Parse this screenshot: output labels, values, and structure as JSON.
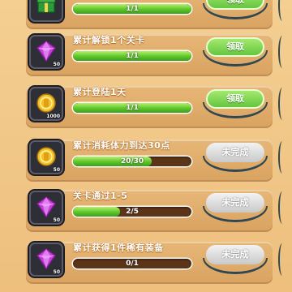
{
  "tasks": [
    {
      "title": "",
      "progress": "1/1",
      "fill": 1.0,
      "button": "领取",
      "state": "claim",
      "icon": "gift-icon",
      "count": ""
    },
    {
      "title": "累计解锁1个关卡",
      "progress": "1/1",
      "fill": 1.0,
      "button": "领取",
      "state": "claim",
      "icon": "purple-gem-icon",
      "count": "50"
    },
    {
      "title": "累计登陆1天",
      "progress": "1/1",
      "fill": 1.0,
      "button": "领取",
      "state": "claim",
      "icon": "gold-coin-icon",
      "count": "1000"
    },
    {
      "title": "累计消耗体力到达30点",
      "progress": "20/30",
      "fill": 0.6667,
      "button": "未完成",
      "state": "todo",
      "icon": "gold-coin-icon",
      "count": "50"
    },
    {
      "title": "关卡通过1-5",
      "progress": "2/5",
      "fill": 0.4,
      "button": "未完成",
      "state": "todo",
      "icon": "purple-gem-icon",
      "count": "50"
    },
    {
      "title": "累计获得1件稀有装备",
      "progress": "0/1",
      "fill": 0.0,
      "button": "未完成",
      "state": "todo",
      "icon": "purple-gem-icon",
      "count": "50"
    }
  ],
  "colors": {
    "claim": "#5fc23c",
    "todo": "#c9c9c9",
    "bar_fill": "#5cc52a",
    "card": "#e0ad6a"
  }
}
